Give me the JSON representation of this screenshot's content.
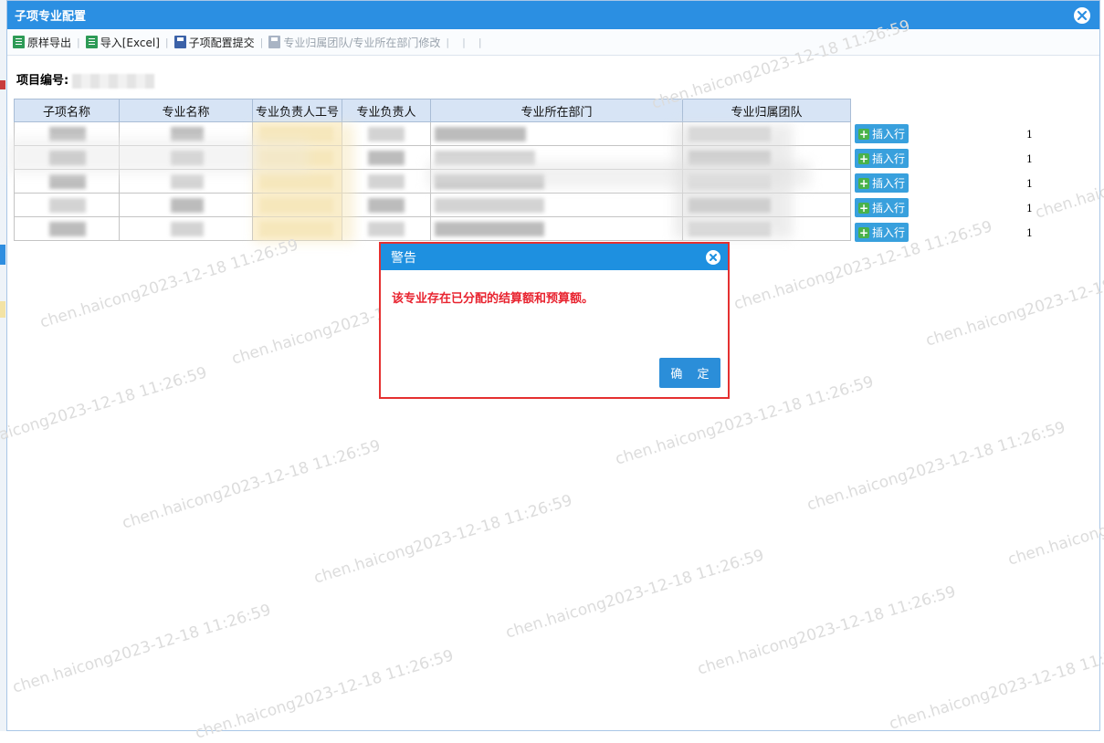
{
  "window": {
    "title": "子项专业配置"
  },
  "toolbar": {
    "items": [
      {
        "label": "原样导出"
      },
      {
        "label": "导入[Excel]"
      },
      {
        "label": "子项配置提交"
      },
      {
        "label": "专业归属团队/专业所在部门修改"
      }
    ]
  },
  "project": {
    "label": "项目编号:"
  },
  "table": {
    "headers": [
      "子项名称",
      "专业名称",
      "专业负责人工号",
      "专业负责人",
      "专业所在部门",
      "专业归属团队"
    ],
    "insert_label": "插入行",
    "row_numbers": [
      "1",
      "1",
      "1",
      "1",
      "1"
    ]
  },
  "dialog": {
    "title": "警告",
    "message": "该专业存在已分配的结算额和预算额。",
    "ok_label": "确 定"
  },
  "watermark": {
    "text": "chen.haicong2023-12-18 11:26:59"
  },
  "colors": {
    "titlebar": "#2b8fe2",
    "alert_text": "#e8232f",
    "button": "#38a0dd",
    "highlight_border": "#e53030"
  }
}
